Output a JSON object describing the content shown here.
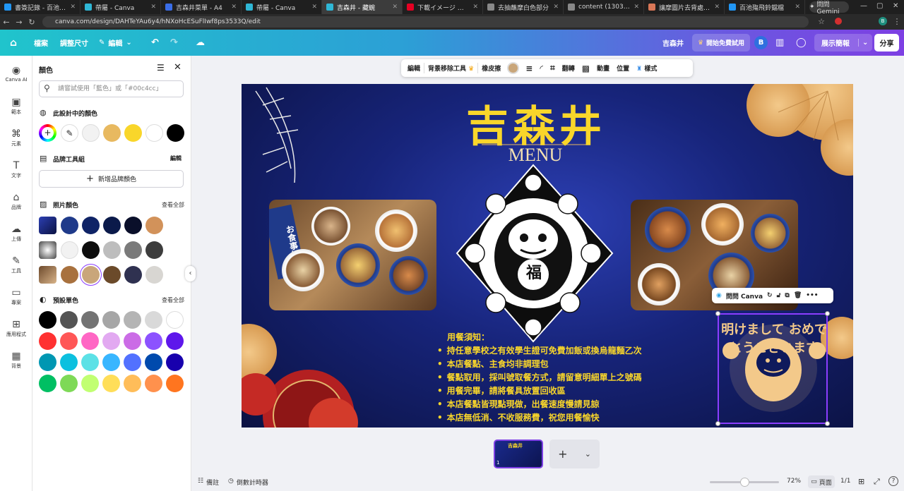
{
  "browser": {
    "tabs": [
      {
        "label": "書簽記錄 - 百池殤飛鈴鐺檔",
        "color": "#2196f3"
      },
      {
        "label": "帶屬 - Canva",
        "color": "#2fb7d6"
      },
      {
        "label": "吉森井菜單 - A4",
        "color": "#3a6ee8"
      },
      {
        "label": "帶屬 - Canva",
        "color": "#2fb7d6"
      },
      {
        "label": "吉森井 - 藏蜿",
        "color": "#2fb7d6",
        "active": true
      },
      {
        "label": "下載イメージ 上的 Pin",
        "color": "#e60023"
      },
      {
        "label": "去抽蘸摩白色部分",
        "color": "#888888"
      },
      {
        "label": "content (1303×1207)",
        "color": "#888888"
      },
      {
        "label": "讓摩圖片去背處理 - Claude",
        "color": "#d97757"
      },
      {
        "label": "百池殤飛鈴鐺檔",
        "color": "#2196f3"
      }
    ],
    "gemini": "問問 Gemini",
    "url": "canva.com/design/DAHTeYAu6y4/hNXoHcESuFlIwf8ps3533Q/edit"
  },
  "topbar": {
    "file": "檔案",
    "resize": "調整尺寸",
    "edit": "編輯",
    "title": "吉森井",
    "trial": "開始免費試用",
    "avatar": "B",
    "present": "展示簡報",
    "share": "分享"
  },
  "rail": [
    {
      "label": "Canva AI",
      "icon": "◉"
    },
    {
      "label": "範本",
      "icon": "▣"
    },
    {
      "label": "元素",
      "icon": "⌘"
    },
    {
      "label": "文字",
      "icon": "T"
    },
    {
      "label": "品牌",
      "icon": "⌂"
    },
    {
      "label": "上傳",
      "icon": "☁"
    },
    {
      "label": "工具",
      "icon": "✎"
    },
    {
      "label": "專案",
      "icon": "▭"
    },
    {
      "label": "應用程式",
      "icon": "⊞"
    },
    {
      "label": "背景",
      "icon": "▦"
    }
  ],
  "panel": {
    "title": "顏色",
    "search_placeholder": "請嘗試使用「藍色」或「#00c4cc」",
    "design_colors_title": "此設計中的顏色",
    "design_colors": [
      "#f2f2f2",
      "#e8b960",
      "#f9d62a",
      "#ffffff",
      "#000000"
    ],
    "brand_kit_title": "品牌工具組",
    "brand_kit_edit": "編輯",
    "add_brand_color": "新增品牌顏色",
    "photo_colors_title": "照片顏色",
    "photo_colors_all": "查看全部",
    "photo_rows": [
      [
        "#1f3a8a",
        "#0f2366",
        "#0b1a4a",
        "#0a0f2a",
        "#d2925a"
      ],
      [
        "#f2f2f2",
        "#0d0d0d",
        "#bdbdbd",
        "#7a7a7a",
        "#3d3d3d"
      ],
      [
        "#a8713e",
        "#c9a67a",
        "#6b4a2a",
        "#2f3150",
        "#d8d6d2"
      ]
    ],
    "default_colors_title": "預設單色",
    "default_colors_all": "查看全部",
    "default_rows": [
      [
        "#000000",
        "#545454",
        "#737373",
        "#a6a6a6",
        "#b4b4b4",
        "#d9d9d9",
        "#ffffff"
      ],
      [
        "#ff3131",
        "#ff5757",
        "#ff66c4",
        "#e2a9f1",
        "#cb6ce6",
        "#8c52ff",
        "#5e17eb"
      ],
      [
        "#0097b2",
        "#0cc0df",
        "#5ce1e6",
        "#38b6ff",
        "#5271ff",
        "#004aad",
        "#1800ad"
      ],
      [
        "#00bf63",
        "#7ed957",
        "#c1ff72",
        "#ffde59",
        "#ffbd59",
        "#ff914d",
        "#ff751f"
      ]
    ]
  },
  "context_toolbar": {
    "edit": "編輯",
    "bg_remove": "背景移除工具",
    "eraser": "橡皮擦",
    "flip": "翻轉",
    "animate": "動畫",
    "position": "位置",
    "style": "樣式"
  },
  "design": {
    "title": "吉森井",
    "menu": "MENU",
    "fu": "福",
    "notes_title": "用餐須知：",
    "notes": [
      "持任意學校之有效學生證可免費加飯或換烏龍麵乙次",
      "本店餐點、主食均非調理包",
      "餐點取用，採叫號取餐方式，請留意明細單上之號碼",
      "用餐完畢，請將餐具放置回收區",
      "本店餐點皆現點現做，出餐速度慢請見諒",
      "本店無低消、不收服務費，祝您用餐愉快"
    ],
    "sticker_text": "明けまして おめでとうございます",
    "photo_sign": "お食事処"
  },
  "selection": {
    "ask": "問問 Canva"
  },
  "bottom": {
    "notes": "備註",
    "timer": "倒數計時器",
    "zoom": "72%",
    "pages_label": "頁面",
    "page_count": "1/1",
    "thumb_num": "1"
  }
}
